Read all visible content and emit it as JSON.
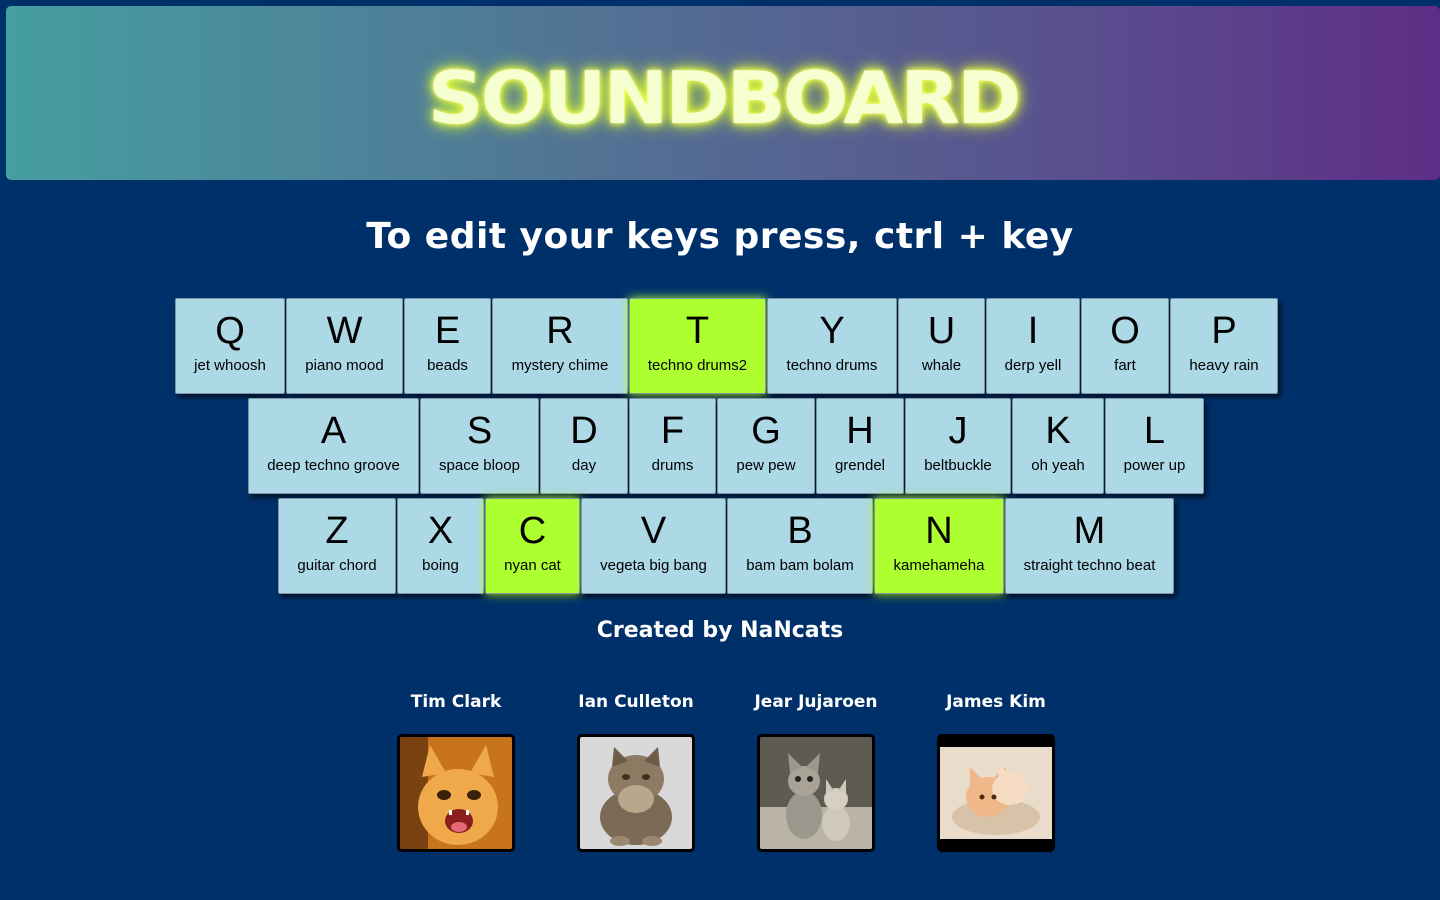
{
  "header": {
    "title": "SOUNDBOARD"
  },
  "instructions": "To edit your keys press, ctrl + key",
  "keyboard": {
    "rows": [
      [
        {
          "letter": "Q",
          "sound": "jet whoosh",
          "active": false
        },
        {
          "letter": "W",
          "sound": "piano mood",
          "active": false
        },
        {
          "letter": "E",
          "sound": "beads",
          "active": false
        },
        {
          "letter": "R",
          "sound": "mystery chime",
          "active": false
        },
        {
          "letter": "T",
          "sound": "techno drums2",
          "active": true
        },
        {
          "letter": "Y",
          "sound": "techno drums",
          "active": false
        },
        {
          "letter": "U",
          "sound": "whale",
          "active": false
        },
        {
          "letter": "I",
          "sound": "derp yell",
          "active": false
        },
        {
          "letter": "O",
          "sound": "fart",
          "active": false
        },
        {
          "letter": "P",
          "sound": "heavy rain",
          "active": false
        }
      ],
      [
        {
          "letter": "A",
          "sound": "deep techno groove",
          "active": false
        },
        {
          "letter": "S",
          "sound": "space bloop",
          "active": false
        },
        {
          "letter": "D",
          "sound": "day",
          "active": false
        },
        {
          "letter": "F",
          "sound": "drums",
          "active": false
        },
        {
          "letter": "G",
          "sound": "pew pew",
          "active": false
        },
        {
          "letter": "H",
          "sound": "grendel",
          "active": false
        },
        {
          "letter": "J",
          "sound": "beltbuckle",
          "active": false
        },
        {
          "letter": "K",
          "sound": "oh yeah",
          "active": false
        },
        {
          "letter": "L",
          "sound": "power up",
          "active": false
        }
      ],
      [
        {
          "letter": "Z",
          "sound": "guitar chord",
          "active": false
        },
        {
          "letter": "X",
          "sound": "boing",
          "active": false
        },
        {
          "letter": "C",
          "sound": "nyan cat",
          "active": true
        },
        {
          "letter": "V",
          "sound": "vegeta big bang",
          "active": false
        },
        {
          "letter": "B",
          "sound": "bam bam bolam",
          "active": false
        },
        {
          "letter": "N",
          "sound": "kamehameha",
          "active": true
        },
        {
          "letter": "M",
          "sound": "straight techno beat",
          "active": false
        }
      ]
    ]
  },
  "colors": {
    "background": "#00306a",
    "key": "#add8e6",
    "key_active": "#adff2f"
  },
  "credits": {
    "title": "Created by NaNcats",
    "members": [
      {
        "name": "Tim Clark",
        "photo": "kitten-photo"
      },
      {
        "name": "Ian Culleton",
        "photo": "fluffy-cat-photo"
      },
      {
        "name": "Jear Jujaroen",
        "photo": "kittens-photo"
      },
      {
        "name": "James Kim",
        "photo": "kittens-hug-photo"
      }
    ]
  }
}
